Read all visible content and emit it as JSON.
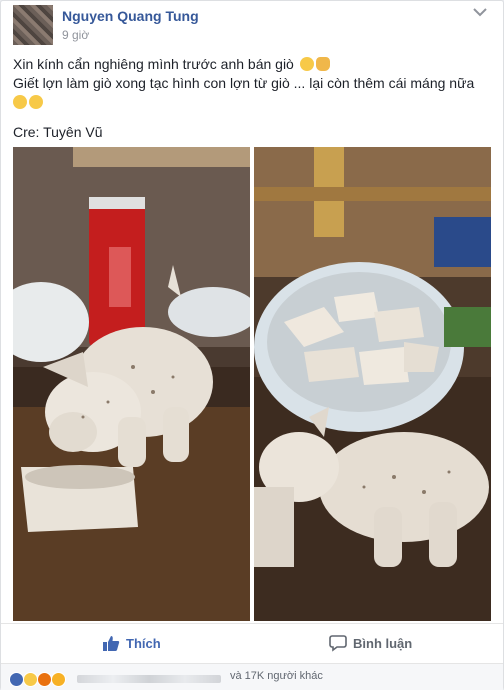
{
  "post": {
    "author": "Nguyen Quang Tung",
    "time": "9 giờ",
    "line1": "Xin kính cẩn nghiêng mình trước anh bán giò",
    "line2": "Giết lợn làm giò xong tạc hình con lợn từ giò ... lại còn thêm cái máng nữa",
    "credit": "Cre: Tuyên Vũ"
  },
  "actions": {
    "like_label": "Thích",
    "comment_label": "Bình luận"
  },
  "reactions": {
    "summary": "và 17K người khác",
    "icons": [
      "like-icon",
      "haha-icon",
      "angry-icon",
      "wow-icon"
    ],
    "colors": {
      "like": "#4267b2",
      "haha": "#f7c948",
      "angry": "#e9710f",
      "wow": "#f7b125"
    }
  },
  "colors": {
    "author": "#365899",
    "text": "#1d2129",
    "muted": "#90949c",
    "like_active": "#4267b2"
  }
}
